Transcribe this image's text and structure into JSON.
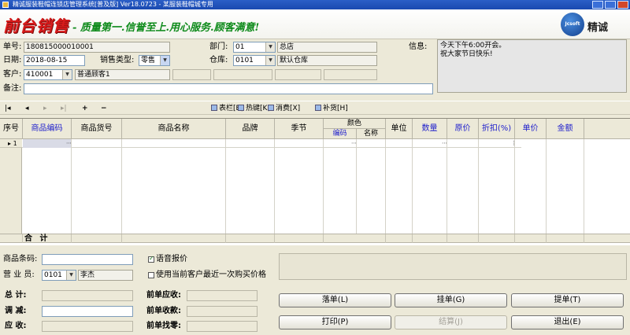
{
  "window": {
    "title": "精诚服装鞋帽连锁店管理系统[普及版] Ver18.0723 - 某服装鞋帽城专用"
  },
  "banner": {
    "brand": "前台销售",
    "slogan": "- 质量第一.信誉至上.用心服务.顾客满意!",
    "logo_small": "Jcsoft",
    "logo_text": "精诚"
  },
  "header": {
    "order_no_label": "单号:",
    "order_no": "180815000010001",
    "date_label": "日期:",
    "date": "2018-08-15",
    "sale_type_label": "销售类型:",
    "sale_type": "零售",
    "customer_label": "客户:",
    "customer_code": "410001",
    "customer_name": "普通顾客1",
    "remark_label": "备注:",
    "remark": "",
    "dept_label": "部门:",
    "dept_code": "01",
    "dept_name": "总店",
    "warehouse_label": "仓库:",
    "warehouse_code": "0101",
    "warehouse_name": "默认仓库",
    "info_label": "信息:",
    "info_text": "今天下午6:00开会。\n祝大家节日快乐!"
  },
  "toolbar": {
    "first": "|◂",
    "prev": "◂",
    "next": "▸",
    "last": "▸|",
    "add": "+",
    "remove": "−",
    "table_bar": "表栏[B]",
    "hotkey": "热键[K]",
    "consume": "消费[X]",
    "supplement": "补货[H]"
  },
  "grid": {
    "columns": {
      "seq": "序号",
      "code": "商品编码",
      "item_no": "商品货号",
      "name": "商品名称",
      "brand": "品牌",
      "season": "季节",
      "color": "颜色",
      "color_code": "编码",
      "color_name": "名称",
      "unit": "单位",
      "qty": "数量",
      "orig_price": "原价",
      "discount": "折扣(%)",
      "price": "单价",
      "amount": "金额"
    },
    "rows": [
      {
        "seq": "1"
      }
    ],
    "total_label": "合 计"
  },
  "bottom": {
    "barcode_label": "商品条码:",
    "barcode": "",
    "voice_label": "语音报价",
    "voice_checked": true,
    "last_price_label": "使用当前客户最近一次购买价格",
    "last_price_checked": false,
    "salesman_label": "营 业 员:",
    "salesman_code": "0101",
    "salesman_name": "李杰",
    "total_label": "总    计:",
    "adjust_label": "调    减:",
    "receivable_label": "应    收:",
    "prev_receivable_label": "前单应收:",
    "prev_received_label": "前单收款:",
    "prev_change_label": "前单找零:"
  },
  "buttons": {
    "hold": "落单(L)",
    "suspend": "挂单(G)",
    "retrieve": "提单(T)",
    "print": "打印(P)",
    "settle": "结算(J)",
    "exit": "退出(E)"
  }
}
